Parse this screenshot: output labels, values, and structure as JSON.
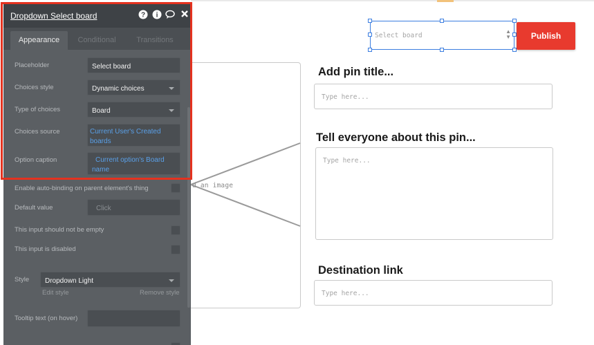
{
  "panel": {
    "title": "Dropdown Select board",
    "header_icons": [
      "help-icon",
      "info-icon",
      "comment-icon",
      "close-icon"
    ],
    "tabs": [
      {
        "label": "Appearance",
        "active": true
      },
      {
        "label": "Conditional",
        "active": false
      },
      {
        "label": "Transitions",
        "active": false
      }
    ],
    "placeholder": {
      "label": "Placeholder",
      "value": "Select board"
    },
    "choices_style": {
      "label": "Choices style",
      "value": "Dynamic choices"
    },
    "type_of_choices": {
      "label": "Type of choices",
      "value": "Board"
    },
    "choices_source": {
      "label": "Choices source",
      "line1": "Current User's Created",
      "line2": "boards"
    },
    "option_caption": {
      "label": "Option caption",
      "line1": "Current option's Board",
      "line2": "name"
    },
    "auto_binding": {
      "label": "Enable auto-binding on parent element's thing"
    },
    "default_value": {
      "label": "Default value",
      "placeholder": "Click"
    },
    "not_empty": {
      "label": "This input should not be empty"
    },
    "disabled": {
      "label": "This input is disabled"
    },
    "style": {
      "label": "Style",
      "value": "Dropdown Light",
      "edit_link": "Edit style",
      "remove_link": "Remove style"
    },
    "tooltip": {
      "label": "Tooltip text (on hover)"
    }
  },
  "canvas": {
    "image_upload_text": "d an image",
    "dropdown": {
      "placeholder": "Select board"
    },
    "publish_label": "Publish",
    "pin_title": {
      "heading": "Add pin title...",
      "placeholder": "Type here..."
    },
    "pin_description": {
      "heading": "Tell everyone about this pin...",
      "placeholder": "Type here..."
    },
    "destination": {
      "heading": "Destination link",
      "placeholder": "Type here..."
    }
  },
  "colors": {
    "accent_red": "#e83a2e",
    "highlight_border": "#e5321f",
    "selection_blue": "#3b7de0",
    "dynamic_link_blue": "#5aa0e8",
    "panel_bg": "#5b5f63"
  }
}
